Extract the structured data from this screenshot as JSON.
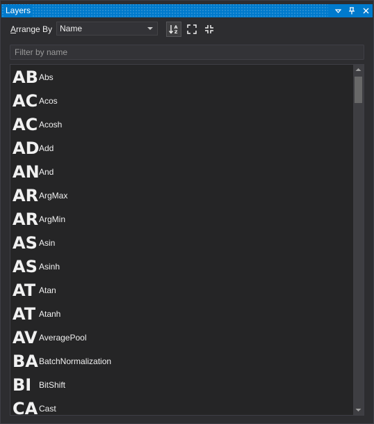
{
  "window": {
    "title": "Layers"
  },
  "toolbar": {
    "arrange_prefix": "A",
    "arrange_rest": "rrange By",
    "arrange_value": "Name",
    "sort_button": "sort-az",
    "expand_button": "expand",
    "collapse_button": "collapse"
  },
  "filter": {
    "placeholder": "Filter by name"
  },
  "layers": [
    {
      "abbr": "AB",
      "name": "Abs"
    },
    {
      "abbr": "AC",
      "name": "Acos"
    },
    {
      "abbr": "AC",
      "name": "Acosh"
    },
    {
      "abbr": "AD",
      "name": "Add"
    },
    {
      "abbr": "AN",
      "name": "And"
    },
    {
      "abbr": "AR",
      "name": "ArgMax"
    },
    {
      "abbr": "AR",
      "name": "ArgMin"
    },
    {
      "abbr": "AS",
      "name": "Asin"
    },
    {
      "abbr": "AS",
      "name": "Asinh"
    },
    {
      "abbr": "AT",
      "name": "Atan"
    },
    {
      "abbr": "AT",
      "name": "Atanh"
    },
    {
      "abbr": "AV",
      "name": "AveragePool"
    },
    {
      "abbr": "BA",
      "name": "BatchNormalization"
    },
    {
      "abbr": "BI",
      "name": "BitShift"
    },
    {
      "abbr": "CA",
      "name": "Cast"
    }
  ],
  "colors": {
    "accent": "#007acc",
    "background": "#2d2d30",
    "list_background": "#252526"
  }
}
